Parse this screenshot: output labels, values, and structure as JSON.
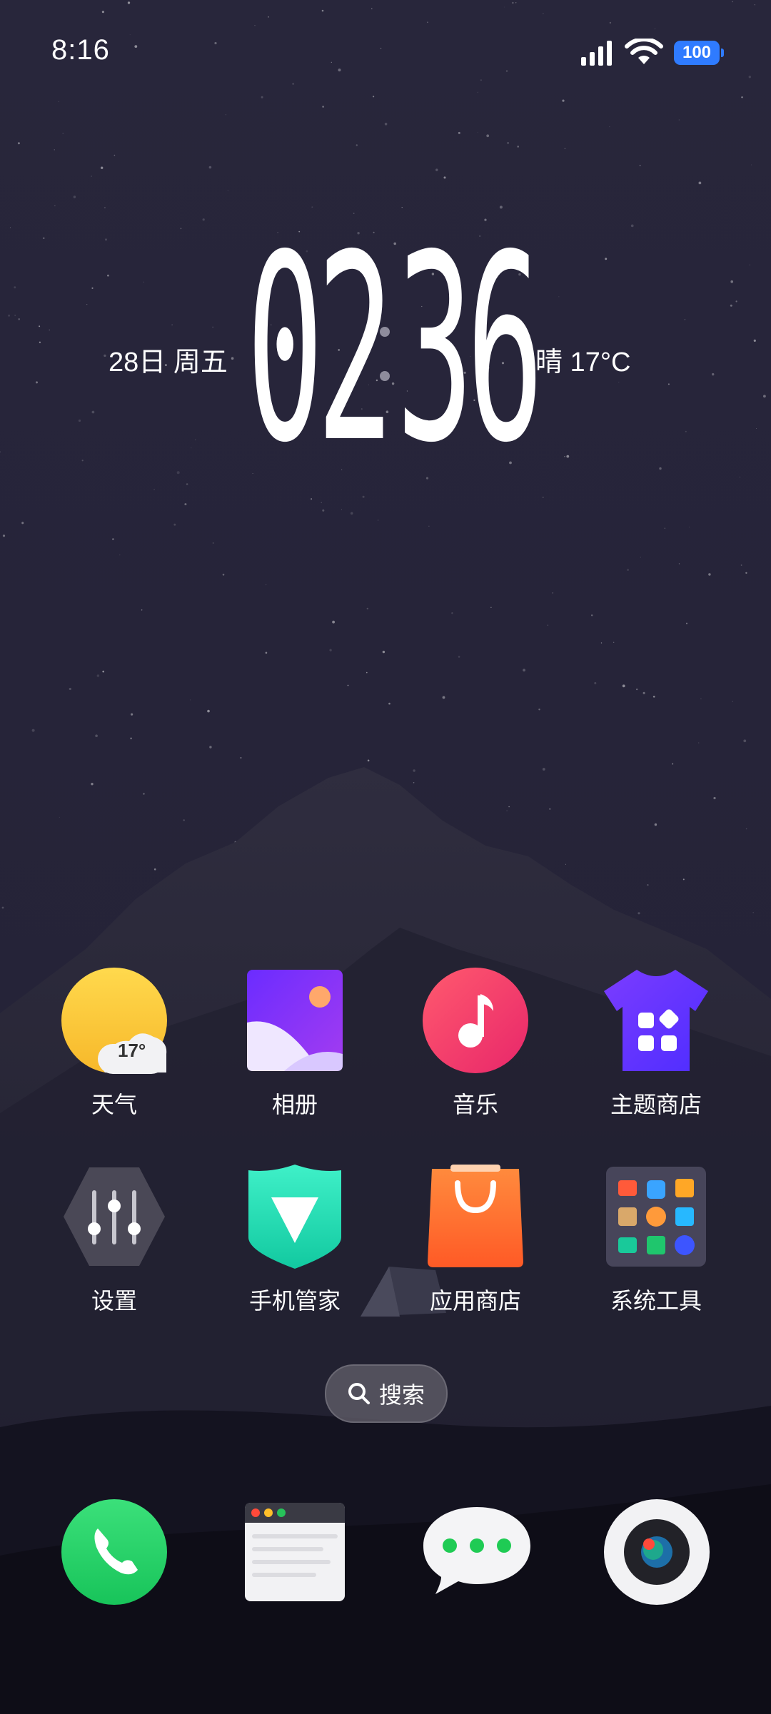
{
  "status_bar": {
    "time": "8:16",
    "battery": "100",
    "icons": [
      "signal-icon",
      "wifi-icon",
      "battery-icon"
    ]
  },
  "clock_widget": {
    "date": "28日 周五",
    "hour": "02",
    "minute": "36",
    "weather": "晴  17°C"
  },
  "apps": [
    {
      "name": "weather",
      "label": "天气",
      "badge": "17°"
    },
    {
      "name": "gallery",
      "label": "相册"
    },
    {
      "name": "music",
      "label": "音乐"
    },
    {
      "name": "theme-store",
      "label": "主题商店"
    },
    {
      "name": "settings",
      "label": "设置"
    },
    {
      "name": "phone-manager",
      "label": "手机管家"
    },
    {
      "name": "app-store",
      "label": "应用商店"
    },
    {
      "name": "system-tools",
      "label": "系统工具"
    }
  ],
  "search": {
    "label": "搜索"
  },
  "dock": [
    {
      "name": "phone",
      "icon": "phone-icon"
    },
    {
      "name": "browser",
      "icon": "browser-icon"
    },
    {
      "name": "messages",
      "icon": "message-icon"
    },
    {
      "name": "camera",
      "icon": "camera-icon"
    }
  ],
  "colors": {
    "sky": "#26243a",
    "mountain": "#1b1a29",
    "battery": "#2f7bff",
    "accent_green": "#25d366"
  }
}
